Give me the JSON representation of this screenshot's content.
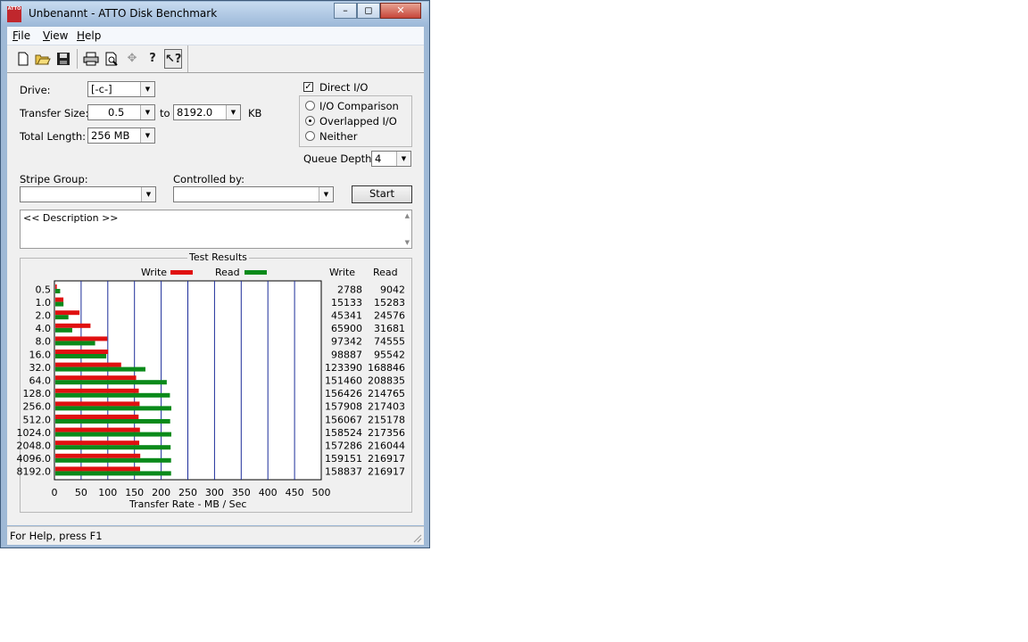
{
  "window": {
    "title": "Unbenannt - ATTO Disk Benchmark",
    "icon_text": "ATTO"
  },
  "titlebar_buttons": [
    "minimize-icon",
    "maximize-icon",
    "close-icon"
  ],
  "menu": [
    {
      "label": "File",
      "u": "F",
      "rest": "ile"
    },
    {
      "label": "View",
      "u": "V",
      "rest": "iew"
    },
    {
      "label": "Help",
      "u": "H",
      "rest": "elp"
    }
  ],
  "toolbar": [
    "new-document-icon",
    "open-folder-icon",
    "save-icon",
    "print-icon",
    "print-preview-icon",
    "move-icon",
    "help-icon",
    "context-help-icon"
  ],
  "settings": {
    "drive_label": "Drive:",
    "drive_value": "[-c-]",
    "transfer_size_label": "Transfer Size:",
    "transfer_from": "0.5",
    "to_label": "to",
    "transfer_to": "8192.0",
    "kb_label": "KB",
    "total_length_label": "Total Length:",
    "total_length_value": "256 MB",
    "direct_io_label": "Direct I/O",
    "direct_io_checked": true,
    "io_modes": [
      {
        "label": "I/O Comparison",
        "selected": false
      },
      {
        "label": "Overlapped I/O",
        "selected": true
      },
      {
        "label": "Neither",
        "selected": false
      }
    ],
    "queue_depth_label": "Queue Depth:",
    "queue_depth_value": "4",
    "stripe_group_label": "Stripe Group:",
    "stripe_group_value": "",
    "controlled_by_label": "Controlled by:",
    "controlled_by_value": "",
    "start_label": "Start",
    "description": "<< Description >>"
  },
  "results": {
    "title": "Test Results",
    "legend_write": "Write",
    "legend_read": "Read",
    "col_write": "Write",
    "col_read": "Read",
    "xlabel": "Transfer Rate - MB / Sec",
    "write_color": "#e01010",
    "read_color": "#0a8a1a"
  },
  "chart_data": {
    "type": "bar",
    "orientation": "horizontal",
    "categories": [
      "0.5",
      "1.0",
      "2.0",
      "4.0",
      "8.0",
      "16.0",
      "32.0",
      "64.0",
      "128.0",
      "256.0",
      "512.0",
      "1024.0",
      "2048.0",
      "4096.0",
      "8192.0"
    ],
    "series": [
      {
        "name": "Write",
        "values": [
          2788,
          15133,
          45341,
          65900,
          97342,
          98887,
          123390,
          151460,
          156426,
          157908,
          156067,
          158524,
          157286,
          159151,
          158837
        ]
      },
      {
        "name": "Read",
        "values": [
          9042,
          15283,
          24576,
          31681,
          74555,
          95542,
          168846,
          208835,
          214765,
          217403,
          215178,
          217356,
          216044,
          216917,
          216917
        ]
      }
    ],
    "xlabel": "Transfer Rate - MB / Sec",
    "xlim": [
      0,
      500
    ],
    "xticks": [
      "0",
      "50",
      "100",
      "150",
      "200",
      "250",
      "300",
      "350",
      "400",
      "450",
      "500"
    ],
    "grid": true
  },
  "status": {
    "text": "For Help, press F1"
  }
}
